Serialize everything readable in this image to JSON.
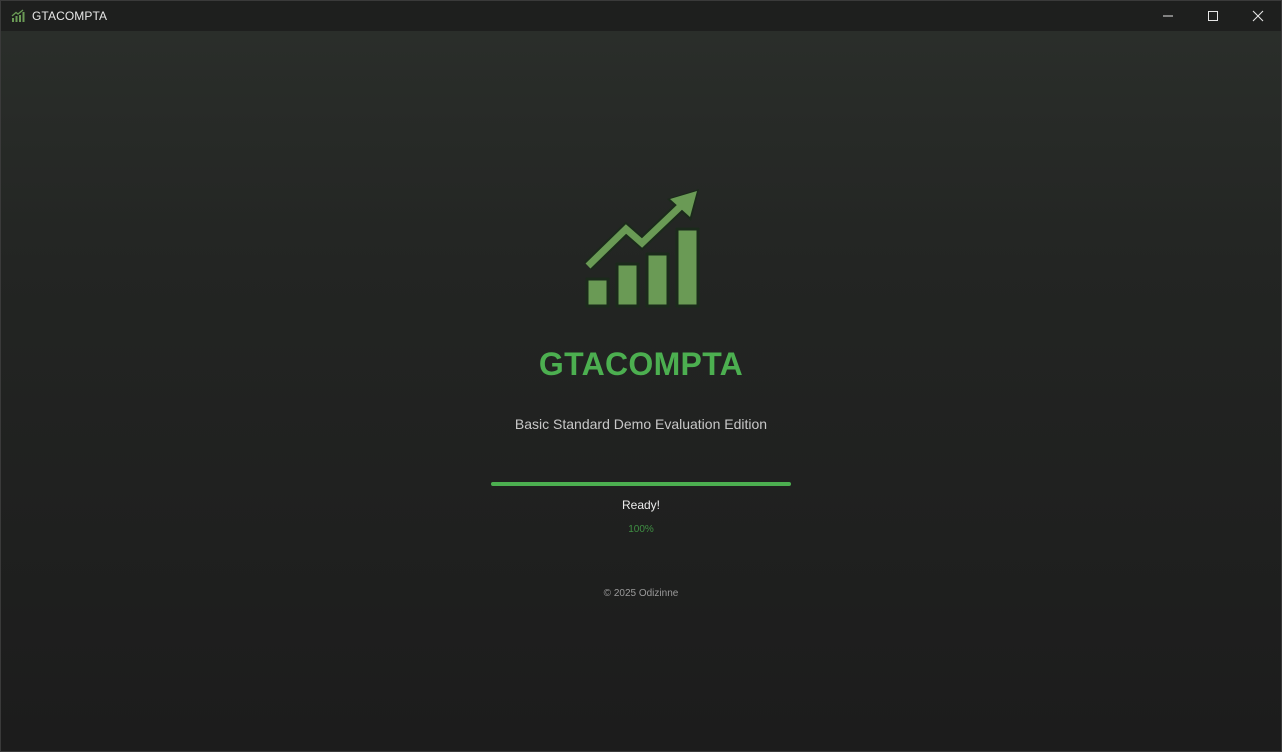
{
  "window": {
    "title": "GTACOMPTA",
    "app_icon": "chart-growth-icon",
    "controls": {
      "minimize_icon": "minimize-icon",
      "maximize_icon": "maximize-icon",
      "close_icon": "close-icon"
    }
  },
  "splash": {
    "logo_icon": "chart-growth-icon",
    "title": "GTACOMPTA",
    "edition": "Basic Standard Demo Evaluation Edition",
    "progress": {
      "value_percent": 100,
      "status": "Ready!",
      "percent_label": "100%"
    },
    "copyright": "© 2025 Odizinne"
  },
  "colors": {
    "accent": "#4caf50",
    "logo_green": "#6a9a55",
    "logo_outline": "#1b2a1b",
    "background_top": "#2b2f2b",
    "background_bottom": "#1c1c1c",
    "titlebar": "#1e1f1e"
  }
}
